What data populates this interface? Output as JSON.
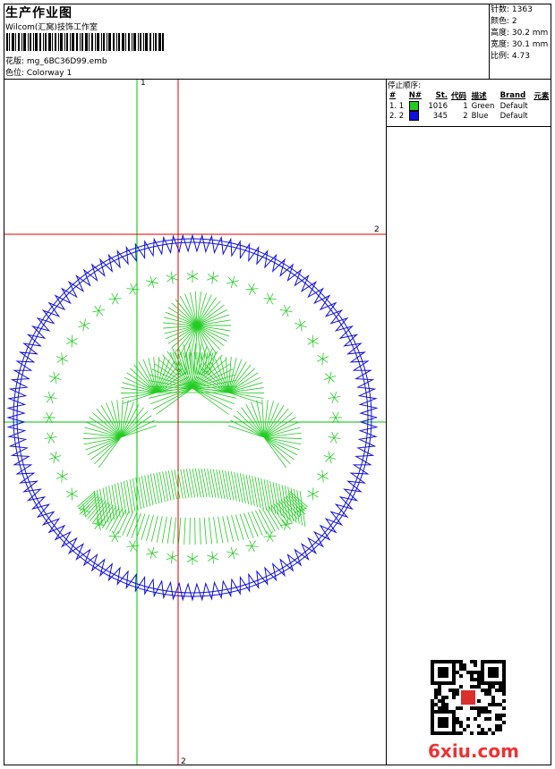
{
  "header": {
    "title": "生产作业图",
    "studio": "Wilcom(汇窝)技饰工作室",
    "design": "花版: mg_6BC36D99.emb",
    "colorway": "色位: Colorway 1"
  },
  "stats": {
    "stitches": "针数: 1363",
    "colors": "颜色: 2",
    "height": "高度: 30.2 mm",
    "width": "宽度: 30.1 mm",
    "scale": "比例: 4.73"
  },
  "stop_sequence": {
    "title": "停止顺序:",
    "headers": [
      "#",
      "N#",
      "St.",
      "代码",
      "描述",
      "Brand",
      "元素"
    ],
    "rows": [
      {
        "idx": "1. 1",
        "color": "#22cc22",
        "st": "1016",
        "code": "1",
        "desc": "Green",
        "brand": "Default"
      },
      {
        "idx": "2. 2",
        "color": "#1010e0",
        "st": "345",
        "code": "2",
        "desc": "Blue",
        "brand": "Default"
      }
    ]
  },
  "guides": {
    "green_top": "1",
    "red_right": "2",
    "red_bottom": "2"
  },
  "watermark": "6xiu.com",
  "colors": {
    "green": "#22cc22",
    "blue": "#1010e0",
    "red": "#e00000",
    "guide_green": "#00c000"
  }
}
